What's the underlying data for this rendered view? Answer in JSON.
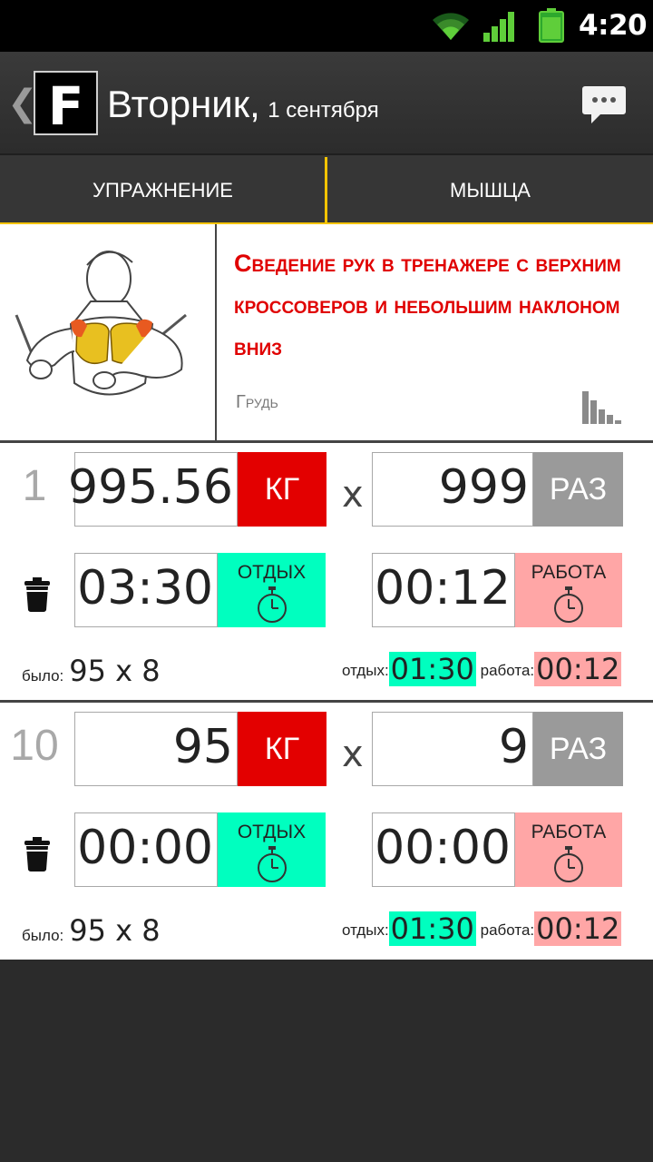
{
  "status_bar": {
    "time": "4:20",
    "icons": [
      "wifi-icon",
      "signal-icon",
      "battery-icon"
    ]
  },
  "action_bar": {
    "back_icon": "chevron-left-icon",
    "logo_letter": "F",
    "day": "Вторник,",
    "date": "1 сентября",
    "chat_icon": "chat-bubble-icon"
  },
  "tabs": [
    {
      "label": "УПРАЖНЕНИЕ"
    },
    {
      "label": "МЫШЦА"
    }
  ],
  "exercise": {
    "name": "Сведение рук в тренажере с верхним кроссоверов и небольшим наклоном вниз",
    "muscle": "Грудь",
    "stats_icon": "bar-chart-icon"
  },
  "sets": [
    {
      "number": "1",
      "weight": "995.56",
      "weight_unit": "КГ",
      "x": "x",
      "reps": "999",
      "reps_unit": "РАЗ",
      "rest_time": "03:30",
      "rest_label": "ОТДЫХ",
      "work_time": "00:12",
      "work_label": "РАБОТА",
      "prev_label": "было:",
      "prev_value": "95 x 8",
      "hist_rest_label": "отдых:",
      "hist_rest": "01:30",
      "hist_work_label": "работа:",
      "hist_work": "00:12"
    },
    {
      "number": "10",
      "weight": "95",
      "weight_unit": "КГ",
      "x": "x",
      "reps": "9",
      "reps_unit": "РАЗ",
      "rest_time": "00:00",
      "rest_label": "ОТДЫХ",
      "work_time": "00:00",
      "work_label": "РАБОТА",
      "prev_label": "было:",
      "prev_value": "95 x 8",
      "hist_rest_label": "отдых:",
      "hist_rest": "01:30",
      "hist_work_label": "работа:",
      "hist_work": "00:12"
    }
  ],
  "colors": {
    "accent": "#f5c400",
    "kg": "#e30000",
    "reps": "#9a9a9a",
    "rest": "#00ffbf",
    "work": "#ffa6a6",
    "exercise_name": "#e00000"
  }
}
